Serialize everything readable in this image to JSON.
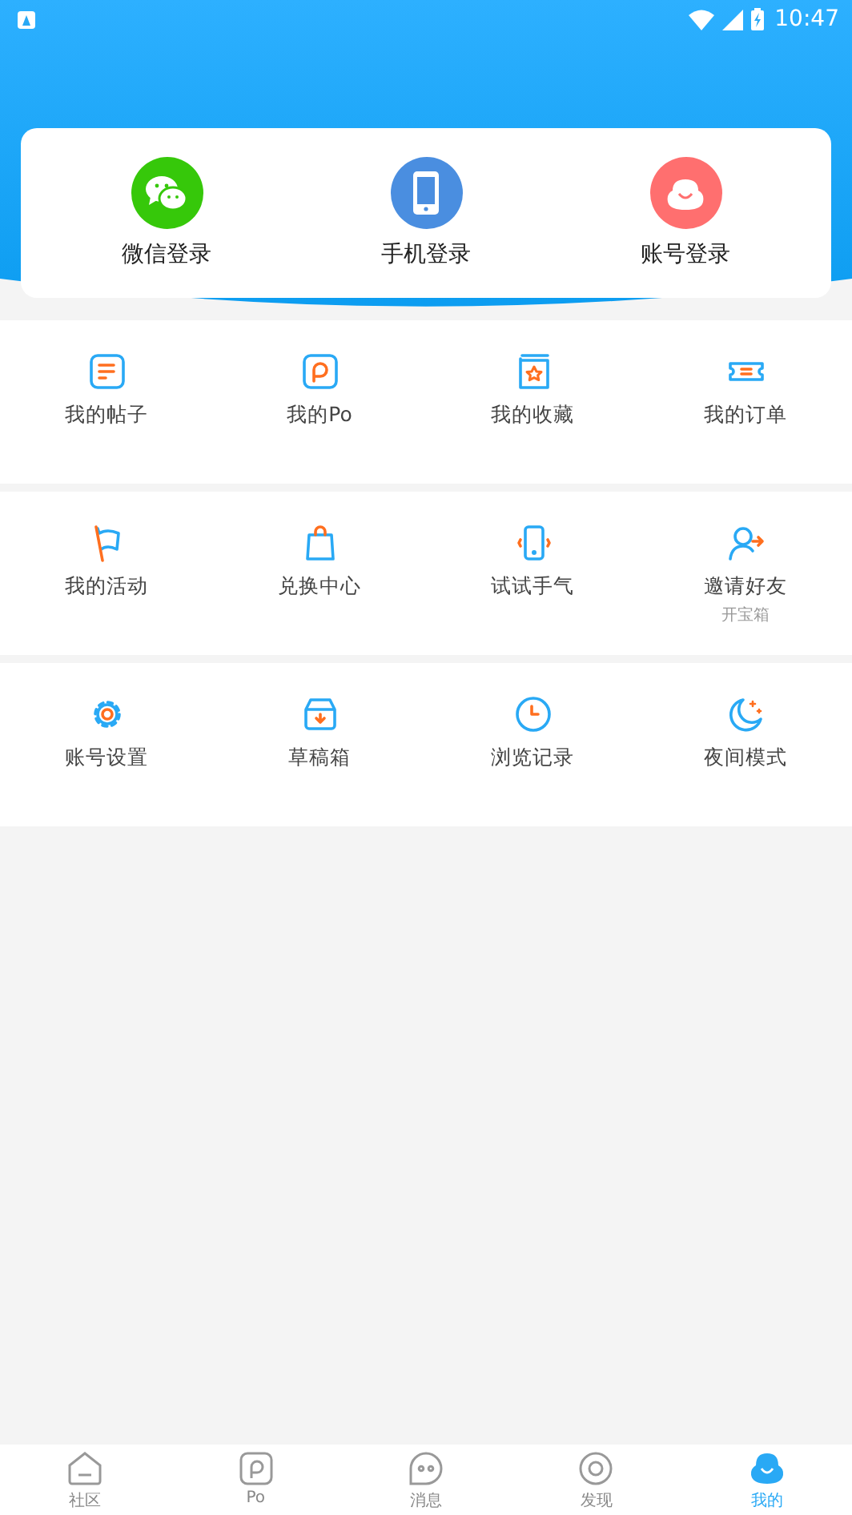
{
  "status_bar": {
    "time": "10:47"
  },
  "login_options": [
    {
      "label": "微信登录",
      "color": "#36c80a"
    },
    {
      "label": "手机登录",
      "color": "#4a8ee0"
    },
    {
      "label": "账号登录",
      "color": "#ff6f6f"
    }
  ],
  "menu_sections": [
    {
      "items": [
        {
          "label": "我的帖子"
        },
        {
          "label": "我的Po"
        },
        {
          "label": "我的收藏"
        },
        {
          "label": "我的订单"
        }
      ]
    },
    {
      "items": [
        {
          "label": "我的活动"
        },
        {
          "label": "兑换中心"
        },
        {
          "label": "试试手气"
        },
        {
          "label": "邀请好友",
          "note": "开宝箱"
        }
      ]
    },
    {
      "items": [
        {
          "label": "账号设置"
        },
        {
          "label": "草稿箱"
        },
        {
          "label": "浏览记录"
        },
        {
          "label": "夜间模式"
        }
      ]
    }
  ],
  "bottom_nav": [
    {
      "label": "社区",
      "selected": false
    },
    {
      "label": "Po",
      "selected": false
    },
    {
      "label": "消息",
      "selected": false
    },
    {
      "label": "发现",
      "selected": false
    },
    {
      "label": "我的",
      "selected": true
    }
  ]
}
